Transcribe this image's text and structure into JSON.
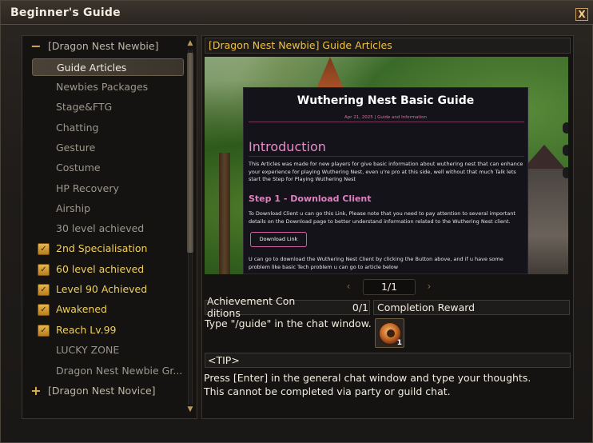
{
  "window": {
    "title": "Beginner's Guide",
    "close_label": "X"
  },
  "tree": {
    "items": [
      {
        "label": "[Dragon Nest Newbie]",
        "expander": "−"
      },
      {
        "label": "Guide Articles"
      },
      {
        "label": "Newbies Packages"
      },
      {
        "label": "Stage&FTG"
      },
      {
        "label": "Chatting"
      },
      {
        "label": "Gesture"
      },
      {
        "label": "Costume"
      },
      {
        "label": "HP Recovery"
      },
      {
        "label": "Airship"
      },
      {
        "label": "30 level achieved"
      },
      {
        "label": "2nd Specialisation",
        "check": "✓"
      },
      {
        "label": "60 level achieved",
        "check": "✓"
      },
      {
        "label": "Level 90 Achieved",
        "check": "✓"
      },
      {
        "label": "Awakened",
        "check": "✓"
      },
      {
        "label": "Reach Lv.99",
        "check": "✓"
      },
      {
        "label": "LUCKY ZONE"
      },
      {
        "label": "Dragon Nest Newbie Gr..."
      },
      {
        "label": "[Dragon Nest Novice]",
        "expander": "+"
      }
    ],
    "selected_index": 1
  },
  "article": {
    "header": "[Dragon Nest Newbie] Guide Articles",
    "doc_title": "Wuthering Nest Basic Guide",
    "doc_date": "Apr 21, 2025 | Guide and Information",
    "intro_heading": "Introduction",
    "intro_text": "This Articles was made for new players for give basic information about wuthering nest that can enhance your experience for playing Wuthering Nest, even u're pro at this side, well without that much Talk lets start the Step for Playing Wuthering Nest",
    "step1_heading": "Step 1 - Download Client",
    "step1_text": "To Download Client u can go this Link, Please note that you need to pay attention to several important details on the Download page to better understand information related to the Wuthering Nest client.",
    "download_button": "Download Link",
    "after_text": "U can go to download the Wuthering Nest Client by clicking the Button above, and if u have some problem like basic Tech problem u can go to article below"
  },
  "pager": {
    "prev": "‹",
    "next": "›",
    "page": "1/1"
  },
  "achievement": {
    "conditions_label": "Achievement Con ditions",
    "progress": "0/1",
    "reward_label": "Completion Reward",
    "description": "Type \"/guide\" in the chat window.",
    "reward_qty": "1",
    "reward_icon": "monster-face-icon"
  },
  "tip": {
    "label": "<TIP>",
    "text_line1": "Press [Enter] in the general chat window and type your thoughts.",
    "text_line2": "This cannot be completed via party or guild chat."
  }
}
